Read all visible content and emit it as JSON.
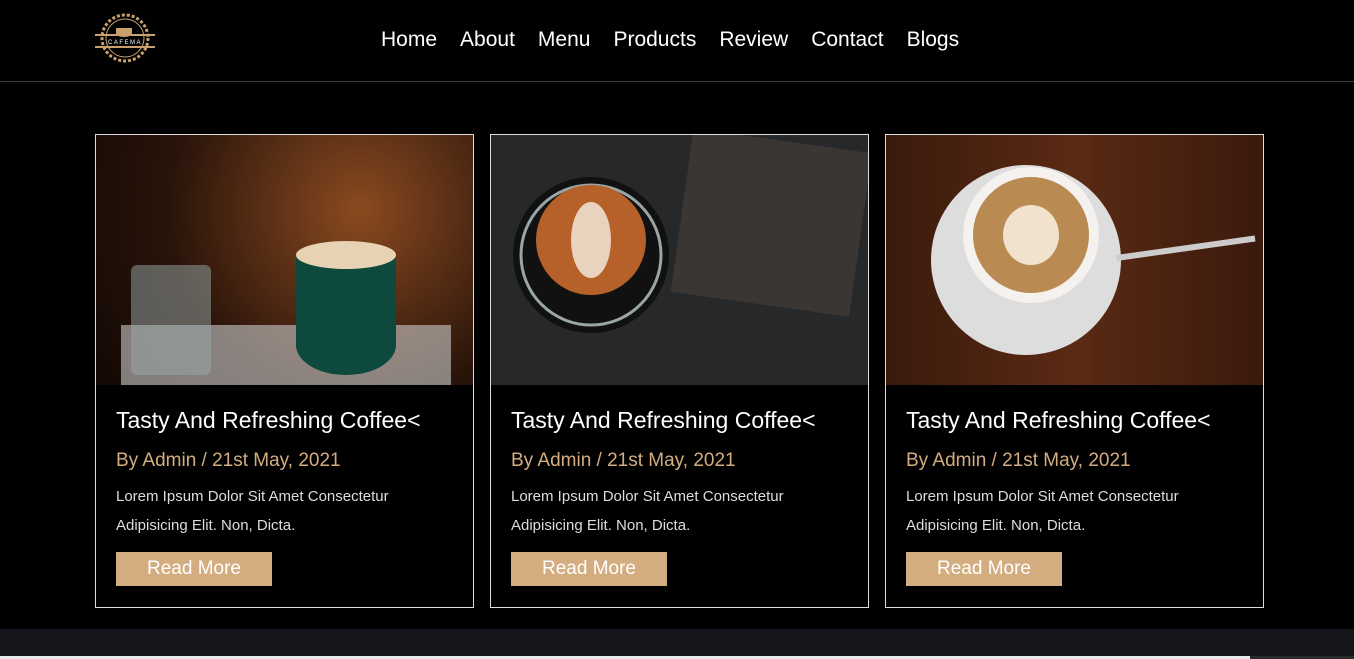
{
  "logo": {
    "text": "CAFEMA"
  },
  "nav": [
    "Home",
    "About",
    "Menu",
    "Products",
    "Review",
    "Contact",
    "Blogs"
  ],
  "cards": [
    {
      "title": "Tasty And Refreshing Coffee<",
      "meta": "By Admin / 21st May, 2021",
      "desc": "Lorem Ipsum Dolor Sit Amet Consectetur Adipisicing Elit. Non, Dicta.",
      "button": "Read More"
    },
    {
      "title": "Tasty And Refreshing Coffee<",
      "meta": "By Admin / 21st May, 2021",
      "desc": "Lorem Ipsum Dolor Sit Amet Consectetur Adipisicing Elit. Non, Dicta.",
      "button": "Read More"
    },
    {
      "title": "Tasty And Refreshing Coffee<",
      "meta": "By Admin / 21st May, 2021",
      "desc": "Lorem Ipsum Dolor Sit Amet Consectetur Adipisicing Elit. Non, Dicta.",
      "button": "Read More"
    }
  ],
  "colors": {
    "accent": "#d3ad7f",
    "background": "#010101"
  }
}
